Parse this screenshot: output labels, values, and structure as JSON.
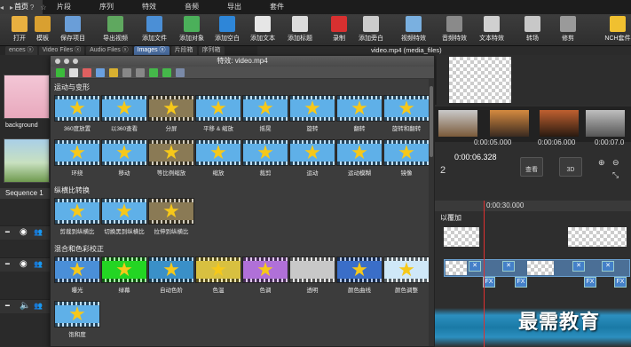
{
  "menu": {
    "tabs": [
      "首页",
      "片段",
      "序列",
      "特效",
      "音频",
      "导出",
      "套件"
    ],
    "right": [
      "◂",
      "▸",
      "⌂",
      "?",
      "☆"
    ]
  },
  "toolbar": [
    {
      "label": "打开",
      "color": "#e8b040"
    },
    {
      "label": "模板",
      "color": "#d9a030"
    },
    {
      "label": "保存项目",
      "color": "#6a9ed8"
    },
    {
      "label": "导出视频",
      "color": "#5fa85f"
    },
    {
      "label": "添加文件",
      "color": "#4b8fd6"
    },
    {
      "label": "添加对象",
      "color": "#4bb05a"
    },
    {
      "label": "添加空白",
      "color": "#2e86d8"
    },
    {
      "label": "添加文本",
      "color": "#e6e6e6"
    },
    {
      "label": "添加标题",
      "color": "#dcdcdc"
    },
    {
      "label": "录制",
      "color": "#d83030"
    },
    {
      "label": "添加旁白",
      "color": "#cccccc"
    },
    {
      "label": "视频特效",
      "color": "#7ab0e0"
    },
    {
      "label": "音频特效",
      "color": "#8a8a8a"
    },
    {
      "label": "文本特效",
      "color": "#d0d0d0"
    },
    {
      "label": "转场",
      "color": "#c8c8c8"
    },
    {
      "label": "修剪",
      "color": "#9a9a9a"
    },
    {
      "label": "NCH套件",
      "color": "#f0c030"
    }
  ],
  "tabs2": [
    "ences ⓧ",
    "Video Files ⓧ",
    "Audio Files ⓧ",
    "Images ⓧ",
    "片段箱",
    "序列箱"
  ],
  "left": {
    "thumb1_label": "background",
    "sequence": "Sequence 1"
  },
  "panel": {
    "title": "特效: video.mp4",
    "sections": [
      {
        "title": "运动与变形",
        "rows": [
          [
            "360度放置",
            "以360查看",
            "分屏",
            "平移 & 缩放",
            "摇晃",
            "旋转",
            "翻转",
            "旋转和翻转"
          ],
          [
            "环绕",
            "移动",
            "等比例缩放",
            "缩放",
            "裁剪",
            "运动",
            "运动模糊",
            "镜像"
          ]
        ]
      },
      {
        "title": "纵横比转换",
        "rows": [
          [
            "剪裁到纵横比",
            "切换黑到纵横比",
            "拉伸到纵横比"
          ]
        ]
      },
      {
        "title": "混合和色彩校正",
        "rows": [
          [
            "曝光",
            "绿幕",
            "自动色阶",
            "色温",
            "色调",
            "透明",
            "颜色曲线",
            "颜色调整"
          ],
          [
            "饱和度"
          ]
        ]
      }
    ]
  },
  "preview": {
    "title": "video.mp4 (media_files)"
  },
  "timeline": {
    "times": [
      "0:00:05.000",
      "0:00:06.000",
      "0:00:07.0"
    ],
    "current": "0:00:06.328",
    "btn_view": "查看",
    "btn_3d": "3D",
    "ruler": "0:00:30.000",
    "overlay_label": "以覆加",
    "fx_label": "FX"
  },
  "watermark": "最需教育"
}
